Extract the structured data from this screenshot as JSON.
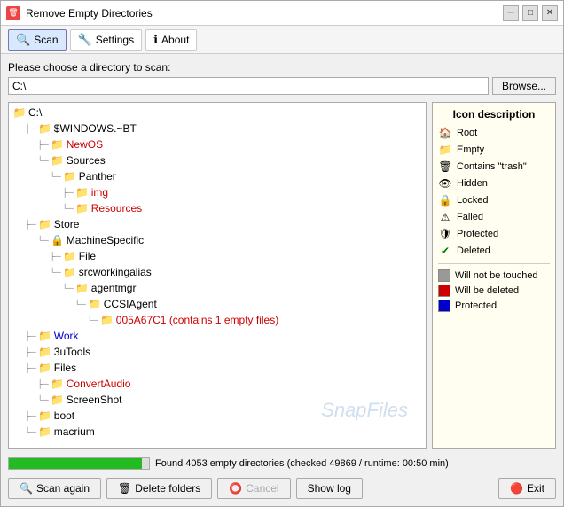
{
  "window": {
    "title": "Remove Empty Directories",
    "icon": "🗑"
  },
  "toolbar": {
    "scan_label": "Scan",
    "settings_label": "Settings",
    "about_label": "About"
  },
  "directory": {
    "label": "Please choose a directory to scan:",
    "value": "C:\\",
    "browse_label": "Browse..."
  },
  "tree": {
    "root": "C:\\"
  },
  "tree_items": [
    {
      "indent": 0,
      "icon": "folder_gray",
      "label": "C:\\",
      "color": "normal"
    },
    {
      "indent": 1,
      "icon": "folder_gray",
      "label": "$WINDOWS.~BT",
      "color": "normal"
    },
    {
      "indent": 2,
      "icon": "folder_red",
      "label": "NewOS",
      "color": "red"
    },
    {
      "indent": 2,
      "icon": "folder_gray",
      "label": "Sources",
      "color": "normal"
    },
    {
      "indent": 3,
      "icon": "folder_gray",
      "label": "Panther",
      "color": "normal"
    },
    {
      "indent": 4,
      "icon": "folder_red",
      "label": "img",
      "color": "red"
    },
    {
      "indent": 4,
      "icon": "folder_red",
      "label": "Resources",
      "color": "red"
    },
    {
      "indent": 1,
      "icon": "folder_gray",
      "label": "Store",
      "color": "normal"
    },
    {
      "indent": 2,
      "icon": "folder_lock",
      "label": "MachineSpecific",
      "color": "normal"
    },
    {
      "indent": 3,
      "icon": "folder_gray",
      "label": "File",
      "color": "normal"
    },
    {
      "indent": 3,
      "icon": "folder_gray",
      "label": "srcworkingalias",
      "color": "normal"
    },
    {
      "indent": 4,
      "icon": "folder_gray",
      "label": "agentmgr",
      "color": "normal"
    },
    {
      "indent": 5,
      "icon": "folder_gray",
      "label": "CCSIAgent",
      "color": "normal"
    },
    {
      "indent": 6,
      "icon": "folder_red",
      "label": "005A67C1 (contains 1 empty files)",
      "color": "red"
    },
    {
      "indent": 1,
      "icon": "folder_gray",
      "label": "Work",
      "color": "blue"
    },
    {
      "indent": 1,
      "icon": "folder_gray",
      "label": "3uTools",
      "color": "normal"
    },
    {
      "indent": 1,
      "icon": "folder_gray",
      "label": "Files",
      "color": "normal"
    },
    {
      "indent": 2,
      "icon": "folder_red",
      "label": "ConvertAudio",
      "color": "red"
    },
    {
      "indent": 2,
      "icon": "folder_gray",
      "label": "ScreenShot",
      "color": "normal"
    },
    {
      "indent": 1,
      "icon": "folder_gray",
      "label": "boot",
      "color": "normal"
    },
    {
      "indent": 1,
      "icon": "folder_gray",
      "label": "macrium",
      "color": "normal"
    }
  ],
  "legend": {
    "title": "Icon description",
    "items": [
      {
        "icon": "root",
        "label": "Root",
        "glyph": "🏠"
      },
      {
        "icon": "empty",
        "label": "Empty",
        "glyph": "📁"
      },
      {
        "icon": "trash",
        "label": "Contains \"trash\"",
        "glyph": "🗑"
      },
      {
        "icon": "hidden",
        "label": "Hidden",
        "glyph": "👁"
      },
      {
        "icon": "locked",
        "label": "Locked",
        "glyph": "🔒"
      },
      {
        "icon": "failed",
        "label": "Failed",
        "glyph": "⚠"
      },
      {
        "icon": "protected",
        "label": "Protected",
        "glyph": "🔒"
      },
      {
        "icon": "deleted",
        "label": "Deleted",
        "glyph": "✔"
      }
    ],
    "color_items": [
      {
        "color": "#999",
        "label": "Will not be touched"
      },
      {
        "color": "#cc0000",
        "label": "Will be deleted"
      },
      {
        "color": "#0000cc",
        "label": "Protected"
      }
    ]
  },
  "progress": {
    "percent": 95,
    "text": "Found 4053 empty directories (checked 49869 / runtime: 00:50 min)"
  },
  "footer": {
    "scan_again": "Scan again",
    "delete_folders": "Delete folders",
    "cancel": "Cancel",
    "show_log": "Show log",
    "exit": "Exit"
  },
  "watermark": "SnapFiles"
}
